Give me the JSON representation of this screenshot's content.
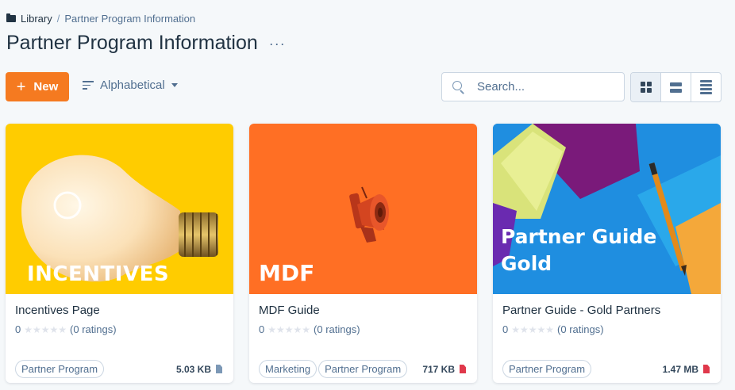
{
  "breadcrumb": {
    "root": "Library",
    "separator": "/",
    "current": "Partner Program Information"
  },
  "page": {
    "title": "Partner Program Information",
    "more": "···"
  },
  "toolbar": {
    "new_label": "New",
    "sort_label": "Alphabetical",
    "search_placeholder": "Search...",
    "views": [
      "grid",
      "rows",
      "list"
    ],
    "active_view": "grid"
  },
  "colors": {
    "accent": "#f57a20",
    "card1_bg": "#ffcc00",
    "card2_bg": "#ff6f24",
    "card3_bg": "#1e8fe0"
  },
  "cards": [
    {
      "thumb_text": "INCENTIVES",
      "title": "Incentives Page",
      "rating": "0",
      "rating_count": "(0 ratings)",
      "tags": [
        "Partner Program"
      ],
      "size": "5.03 KB",
      "file_icon": "doc-icon"
    },
    {
      "thumb_text": "MDF",
      "title": "MDF Guide",
      "rating": "0",
      "rating_count": "(0 ratings)",
      "tags": [
        "Marketing",
        "Partner Program"
      ],
      "size": "717 KB",
      "file_icon": "pdf-icon"
    },
    {
      "thumb_text_1": "Partner Guide",
      "thumb_text_2": "Gold",
      "title": "Partner Guide - Gold Partners",
      "rating": "0",
      "rating_count": "(0 ratings)",
      "tags": [
        "Partner Program"
      ],
      "size": "1.47 MB",
      "file_icon": "pdf-icon"
    }
  ]
}
